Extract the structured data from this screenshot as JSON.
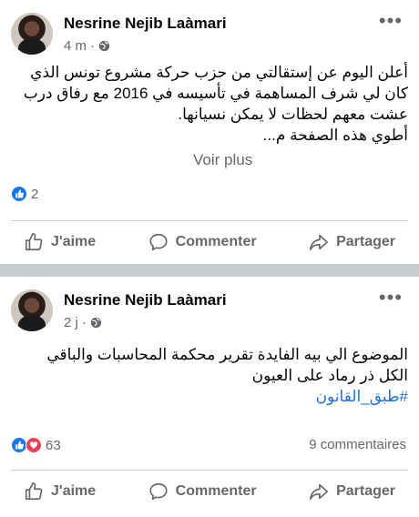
{
  "posts": [
    {
      "author": "Nesrine Nejib Laàmari",
      "time": "4 m",
      "text_lines": [
        "أعلن اليوم عن إستقالتي من حزب حركة مشروع تونس الذي",
        "كان لي شرف المساهمة في تأسيسه في 2016 مع رفاق درب",
        "عشت معهم لحظات لا يمكن نسيانها.",
        "أطوي هذه الصفحة م..."
      ],
      "see_more": "Voir plus",
      "reaction_count": "2",
      "comments_count": "",
      "actions": {
        "like": "J'aime",
        "comment": "Commenter",
        "share": "Partager"
      }
    },
    {
      "author": "Nesrine Nejib Laàmari",
      "time": "2 j",
      "text_lines": [
        "الموضوع الي بيه الفايدة تقرير محكمة المحاسبات والباقي",
        "الكل ذر رماد على العيون"
      ],
      "hashtag": "#طبق_القانون",
      "reaction_count": "63",
      "comments_count": "9 commentaires",
      "actions": {
        "like": "J'aime",
        "comment": "Commenter",
        "share": "Partager"
      }
    }
  ],
  "icons": {
    "more": "more-dots-icon",
    "audience": "globe-icon",
    "like": "thumbs-up-icon",
    "comment": "comment-bubble-icon",
    "share": "share-arrow-icon",
    "reaction_like": "like-reaction-icon",
    "reaction_love": "love-reaction-icon"
  },
  "colors": {
    "like_blue": "#1877f2",
    "love_red": "#f33e58",
    "muted": "#65676b",
    "link": "#216fdb",
    "separator": "#c9ccd1"
  }
}
